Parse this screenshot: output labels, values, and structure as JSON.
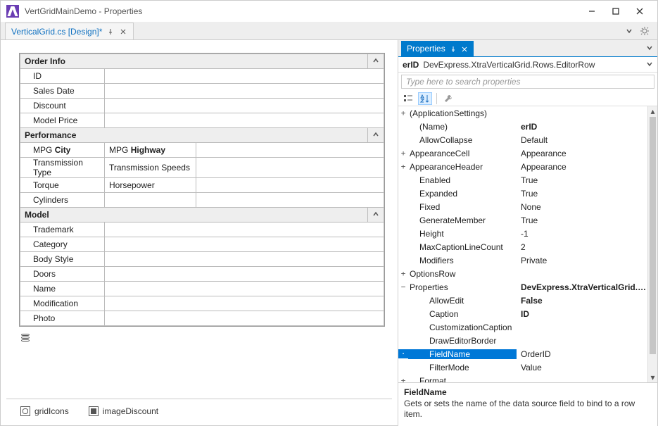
{
  "window": {
    "title": "VertGridMainDemo - Properties"
  },
  "docTab": {
    "label": "VerticalGrid.cs [Design]*"
  },
  "vgrid": {
    "order_info": {
      "title": "Order Info",
      "rows": [
        "ID",
        "Sales Date",
        "Discount",
        "Model Price"
      ]
    },
    "performance": {
      "title": "Performance",
      "pairs": [
        [
          "MPG",
          "City",
          "MPG",
          "Highway"
        ],
        [
          "Transmission Type",
          "",
          "Transmission Speeds",
          ""
        ],
        [
          "Torque",
          "",
          "Horsepower",
          ""
        ],
        [
          "Cylinders",
          "",
          "",
          ""
        ]
      ]
    },
    "model": {
      "title": "Model",
      "rows": [
        "Trademark",
        "Category",
        "Body Style",
        "Doors",
        "Name",
        "Modification",
        "Photo"
      ]
    }
  },
  "footer": {
    "item1": "gridIcons",
    "item2": "imageDiscount"
  },
  "properties": {
    "panelTitle": "Properties",
    "objectId": "erID",
    "objectType": "DevExpress.XtraVerticalGrid.Rows.EditorRow",
    "searchPlaceholder": "Type here to search properties",
    "rows": [
      {
        "exp": "+",
        "name": "(ApplicationSettings)",
        "val": "",
        "ind": 0,
        "bold": false
      },
      {
        "exp": "",
        "name": "(Name)",
        "val": "erID",
        "ind": 1,
        "bold": true
      },
      {
        "exp": "",
        "name": "AllowCollapse",
        "val": "Default",
        "ind": 1,
        "bold": false
      },
      {
        "exp": "+",
        "name": "AppearanceCell",
        "val": "Appearance",
        "ind": 0,
        "bold": false
      },
      {
        "exp": "+",
        "name": "AppearanceHeader",
        "val": "Appearance",
        "ind": 0,
        "bold": false
      },
      {
        "exp": "",
        "name": "Enabled",
        "val": "True",
        "ind": 1,
        "bold": false
      },
      {
        "exp": "",
        "name": "Expanded",
        "val": "True",
        "ind": 1,
        "bold": false
      },
      {
        "exp": "",
        "name": "Fixed",
        "val": "None",
        "ind": 1,
        "bold": false
      },
      {
        "exp": "",
        "name": "GenerateMember",
        "val": "True",
        "ind": 1,
        "bold": false
      },
      {
        "exp": "",
        "name": "Height",
        "val": "-1",
        "ind": 1,
        "bold": false
      },
      {
        "exp": "",
        "name": "MaxCaptionLineCount",
        "val": "2",
        "ind": 1,
        "bold": false
      },
      {
        "exp": "",
        "name": "Modifiers",
        "val": "Private",
        "ind": 1,
        "bold": false
      },
      {
        "exp": "+",
        "name": "OptionsRow",
        "val": "",
        "ind": 0,
        "bold": false
      },
      {
        "exp": "−",
        "name": "Properties",
        "val": "DevExpress.XtraVerticalGrid.Row",
        "ind": 0,
        "bold": true
      },
      {
        "exp": "",
        "name": "AllowEdit",
        "val": "False",
        "ind": 2,
        "bold": true
      },
      {
        "exp": "",
        "name": "Caption",
        "val": "ID",
        "ind": 2,
        "bold": true
      },
      {
        "exp": "",
        "name": "CustomizationCaption",
        "val": "",
        "ind": 2,
        "bold": false
      },
      {
        "exp": "",
        "name": "DrawEditorBorder",
        "val": "",
        "ind": 2,
        "bold": false
      },
      {
        "exp": "",
        "name": "FieldName",
        "val": "OrderID",
        "ind": 2,
        "bold": false,
        "selected": true
      },
      {
        "exp": "",
        "name": "FilterMode",
        "val": "Value",
        "ind": 2,
        "bold": false
      },
      {
        "exp": "+",
        "name": "Format",
        "val": "",
        "ind": 1,
        "bold": false
      }
    ],
    "description": {
      "name": "FieldName",
      "text": "Gets or sets the name of the data source field to bind to a row item."
    }
  }
}
